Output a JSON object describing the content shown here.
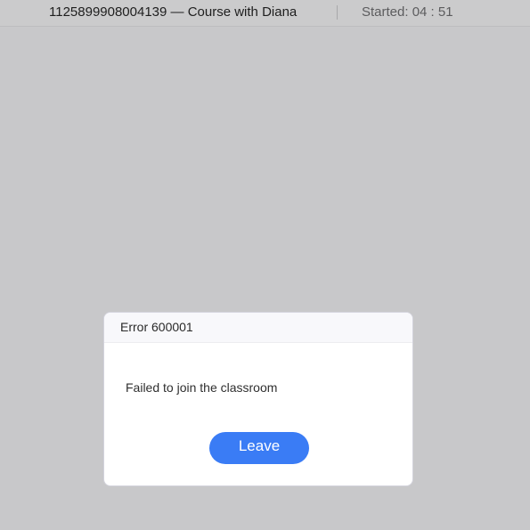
{
  "header": {
    "room_title": "1125899908004139 — Course with Diana",
    "timer_text": "Started: 04 : 51"
  },
  "dialog": {
    "title": "Error 600001",
    "message": "Failed to join the classroom",
    "leave_label": "Leave",
    "accent_color": "#3a7cf5"
  },
  "colors": {
    "background": "#c8c8ca",
    "dialog_background": "#ffffff"
  }
}
